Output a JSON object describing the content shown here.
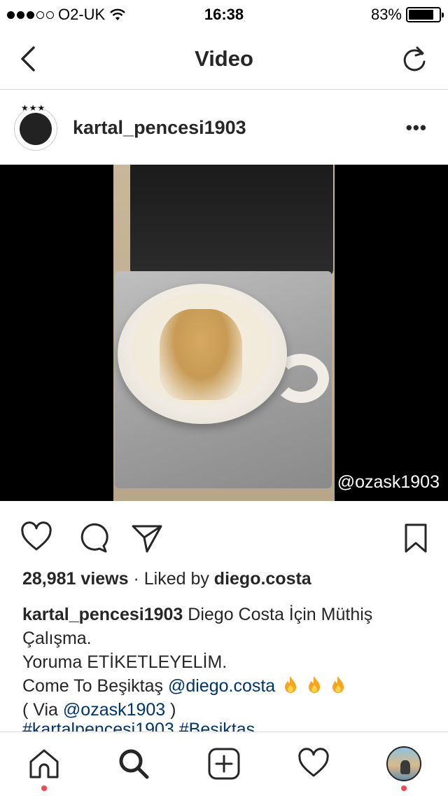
{
  "status_bar": {
    "carrier": "O2-UK",
    "time": "16:38",
    "battery_percent": "83%",
    "battery_level": 0.83,
    "signal_bars_filled": 3,
    "signal_bars_total": 5
  },
  "nav": {
    "title": "Video",
    "back_icon": "chevron-left-icon",
    "refresh_icon": "refresh-icon"
  },
  "post": {
    "username": "kartal_pencesi1903",
    "more_label": "•••",
    "watermark": "@ozask1903",
    "views": "28,981 views",
    "separator": " · ",
    "liked_by_prefix": "Liked by ",
    "liked_by_user": "diego.costa",
    "caption": {
      "user": "kartal_pencesi1903",
      "line1_text": " Diego Costa İçin Müthiş",
      "line2_text": "Çalışma.",
      "line3_text": "Yoruma ETİKETLEYELİM.",
      "line4_prefix": "Come To Beşiktaş ",
      "line4_mention": "@diego.costa",
      "line5_prefix": "( Via ",
      "line5_mention": "@ozask1903",
      "line5_suffix": " )",
      "line6_partial": "#kartalpencesi1903 #Besiktas"
    }
  },
  "colors": {
    "link": "#003569",
    "text": "#262626",
    "notification_dot": "#ed4956",
    "divider": "#dbdbdb"
  },
  "tabs": [
    {
      "icon": "home-icon",
      "notification": true
    },
    {
      "icon": "search-icon",
      "notification": false
    },
    {
      "icon": "add-post-icon",
      "notification": false
    },
    {
      "icon": "heart-icon",
      "notification": false
    },
    {
      "icon": "profile-avatar",
      "notification": true
    }
  ]
}
